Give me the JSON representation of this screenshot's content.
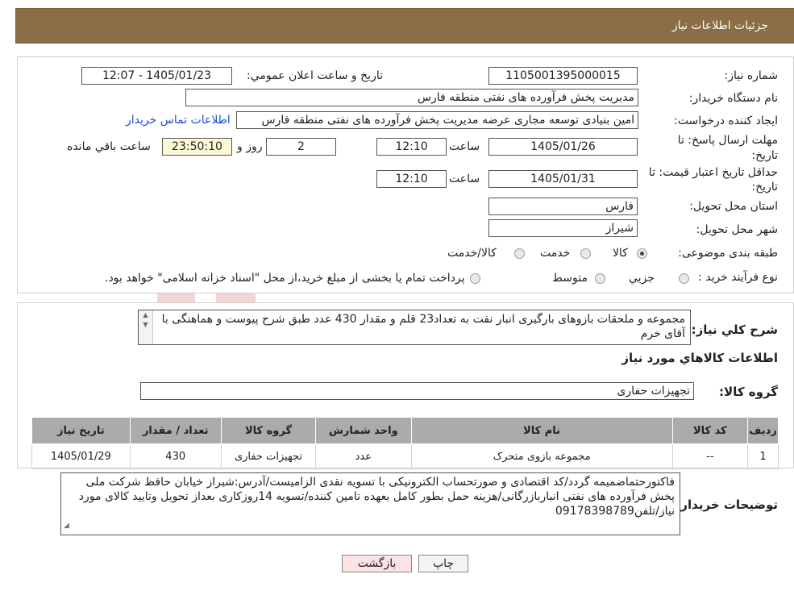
{
  "header": {
    "title": "جزئیات اطلاعات نیاز"
  },
  "form": {
    "need_number_label": "شماره نیاز:",
    "need_number": "1105001395000015",
    "announce_label": "تاریخ و ساعت اعلان عمومي:",
    "announce_value": "1405/01/23 - 12:07",
    "buyer_org_label": "نام دستگاه خریدار:",
    "buyer_org": "مدیریت پخش فرآورده های نفتی منطقه فارس",
    "creator_label": "ایجاد کننده درخواست:",
    "creator": "امین بنیادی توسعه مجاری عرضه مدیریت پخش فرآورده های نفتی منطقه فارس",
    "contact_link": "اطلاعات تماس خریدار",
    "deadline_label_1": "مهلت ارسال پاسخ: تا",
    "deadline_label_2": "تاریخ:",
    "deadline_date": "1405/01/26",
    "time_label": "ساعت",
    "deadline_time": "12:10",
    "days": "2",
    "days_label": "روز و",
    "remaining": "23:50:10",
    "remaining_label": "ساعت باقي مانده",
    "validity_label_1": "حداقل تاریخ اعتبار قیمت: تا",
    "validity_label_2": "تاریخ:",
    "validity_date": "1405/01/31",
    "validity_time": "12:10",
    "province_label": "استان محل تحویل:",
    "province": "فارس",
    "city_label": "شهر محل تحویل:",
    "city": "شیراز",
    "category_label": "طبقه بندی موضوعی:",
    "category_options": [
      "کالا",
      "خدمت",
      "کالا/خدمت"
    ],
    "process_label": "نوع فرآیند خرید :",
    "process_options": [
      "جزیي",
      "متوسط"
    ],
    "process_note": "پرداخت تمام یا بخشی از مبلغ خرید،از محل \"اسناد خزانه اسلامی\" خواهد بود."
  },
  "summary": {
    "label": "شرح كلي نياز:",
    "text": "مجموعه و ملحقات بازوهای بارگیری انبار نفت به تعداد23 قلم و مقدار 430 عدد طبق شرح پیوست و هماهنگی با آقای خرم",
    "goods_title": "اطلاعات كالاهاي مورد نياز",
    "group_label": "گروه کالا:",
    "group_value": "تجهیزات حفاری"
  },
  "table": {
    "headers": [
      "ردیف",
      "کد کالا",
      "نام کالا",
      "واحد شمارش",
      "گروه کالا",
      "تعداد / مقدار",
      "تاریخ نیاز"
    ],
    "rows": [
      [
        "1",
        "--",
        "مجموعه بازوی متحرک",
        "عدد",
        "تجهیزات حفاری",
        "430",
        "1405/01/29"
      ]
    ]
  },
  "buyer_notes": {
    "label": "توضیحات خریدار:",
    "text": "فاکتورحتماضمیمه گردد/کد اقتصادی و صورتحساب الکترونیکی با تسویه نقدی الزامیست/آدرس:شیراز خیابان حافظ شرکت ملی پخش فرآورده های نفتی انباربازرگانی/هزینه حمل بطور کامل بعهده تامین کننده/تسویه 14روزکاری بعداز تحویل وتایید کالای مورد نیاز/تلفن09178398789"
  },
  "buttons": {
    "print": "چاپ",
    "back": "بازگشت"
  },
  "colors": {
    "header": "#8b6d46",
    "table_header": "#ababab",
    "remaining_bg": "#fdf8d6",
    "back_button": "#fbe3e3",
    "link": "#1a4fd6"
  }
}
